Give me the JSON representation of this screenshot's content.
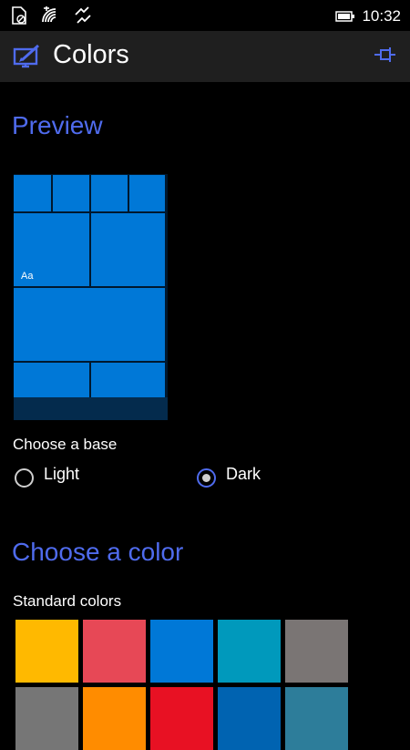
{
  "status_bar": {
    "time": "10:32",
    "icons": [
      "no-sim-icon",
      "wifi-icon",
      "data-sync-icon",
      "battery-icon"
    ]
  },
  "title_bar": {
    "title": "Colors",
    "icon": "paintbrush-monitor-icon",
    "pin_icon": "pin-icon"
  },
  "preview": {
    "heading": "Preview",
    "tile_text": "Aa",
    "accent": "#0078d7"
  },
  "base": {
    "label": "Choose a base",
    "options": [
      {
        "label": "Light",
        "selected": false
      },
      {
        "label": "Dark",
        "selected": true
      }
    ]
  },
  "colors": {
    "heading": "Choose a color",
    "standard_label": "Standard colors",
    "swatches": [
      "#ffb900",
      "#e74856",
      "#0078d7",
      "#0099bc",
      "#7a7574",
      "#767676",
      "#ff8c00",
      "#e81123",
      "#0063b1",
      "#2d7d9a"
    ]
  },
  "theme": {
    "accent_text": "#4f6bed",
    "background": "#000000",
    "title_bar": "#1f1f1f"
  }
}
